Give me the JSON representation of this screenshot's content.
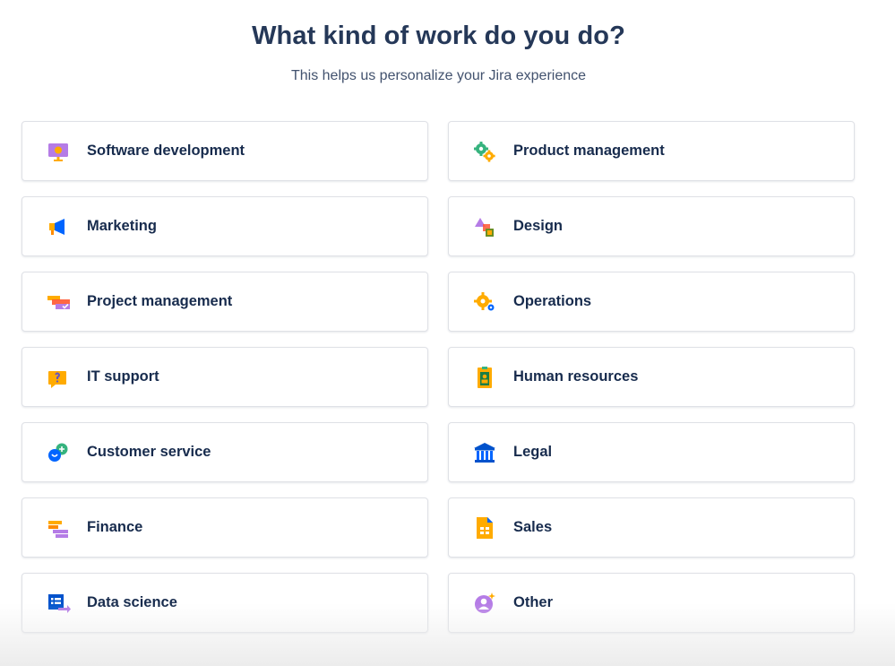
{
  "header": {
    "title": "What kind of work do you do?",
    "subtitle": "This helps us personalize your Jira experience"
  },
  "options": [
    {
      "label": "Software development",
      "icon": "monitor-icon"
    },
    {
      "label": "Product management",
      "icon": "gears-icon"
    },
    {
      "label": "Marketing",
      "icon": "megaphone-icon"
    },
    {
      "label": "Design",
      "icon": "shapes-icon"
    },
    {
      "label": "Project management",
      "icon": "timeline-icon"
    },
    {
      "label": "Operations",
      "icon": "cog-icon"
    },
    {
      "label": "IT support",
      "icon": "question-bubble-icon"
    },
    {
      "label": "Human resources",
      "icon": "badge-icon"
    },
    {
      "label": "Customer service",
      "icon": "chat-bubbles-icon"
    },
    {
      "label": "Legal",
      "icon": "courthouse-icon"
    },
    {
      "label": "Finance",
      "icon": "bars-icon"
    },
    {
      "label": "Sales",
      "icon": "document-icon"
    },
    {
      "label": "Data science",
      "icon": "data-window-icon"
    },
    {
      "label": "Other",
      "icon": "person-sparkle-icon"
    }
  ],
  "colors": {
    "title": "#253858",
    "text": "#172b4d",
    "card_border": "#dfe1e6"
  }
}
